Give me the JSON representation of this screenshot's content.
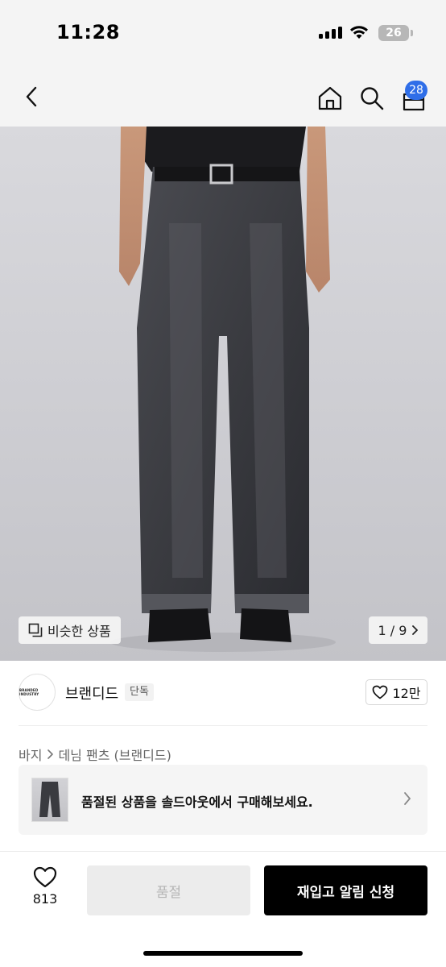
{
  "status_bar": {
    "time": "11:28",
    "battery": "26"
  },
  "nav": {
    "cart_count": "28",
    "icons": [
      "chevron-left-icon",
      "home-icon",
      "search-icon",
      "cart-icon"
    ]
  },
  "hero": {
    "similar_label": "비슷한 상품",
    "pager": "1 / 9"
  },
  "brand": {
    "logo_text": "BRANDED INDUSTRY",
    "name": "브랜디드",
    "tag": "단독",
    "likes": "12만"
  },
  "breadcrumb": {
    "category": "바지",
    "subcategory": "데님 팬츠 (브랜디드)"
  },
  "banner": {
    "text": "품절된 상품을 솔드아웃에서 구매해보세요."
  },
  "bottom_bar": {
    "wish_count": "813",
    "soldout_label": "품절",
    "restock_label": "재입고 알림 신청"
  }
}
